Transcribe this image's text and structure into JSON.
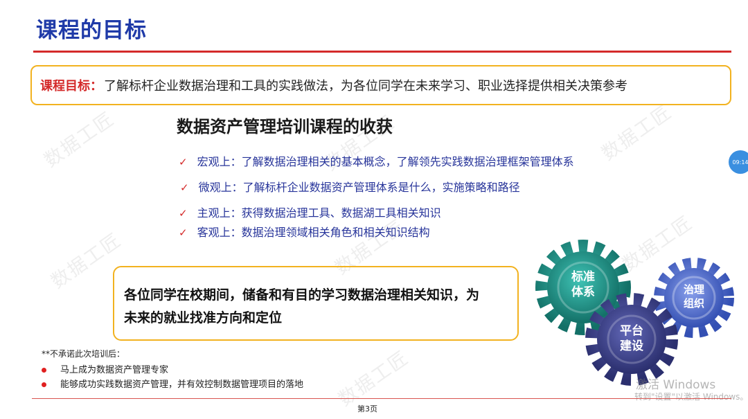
{
  "slide": {
    "title": "课程的目标",
    "goal": {
      "label": "课程目标：",
      "text": "了解标杆企业数据治理和工具的实践做法，为各位同学在未来学习、职业选择提供相关决策参考"
    },
    "gains": {
      "title": "数据资产管理培训课程的收获",
      "check_symbol": "✓",
      "items": [
        {
          "label": "宏观上：",
          "text": "了解数据治理相关的基本概念，了解领先实践数据治理框架管理体系"
        },
        {
          "label": "微观上：",
          "text": "了解标杆企业数据资产管理体系是什么，实施策略和路径"
        },
        {
          "label": "主观上：",
          "text": "获得数据治理工具、数据湖工具相关知识"
        },
        {
          "label": "客观上：",
          "text": "数据治理领域相关角色和相关知识结构"
        }
      ]
    },
    "advice": {
      "line1": "各位同学在校期间，储备和有目的学习数据治理相关知识，为",
      "line2": "未来的就业找准方向和定位"
    },
    "disclaimer": {
      "title": "**不承诺此次培训后：",
      "items": [
        "马上成为数据资产管理专家",
        "能够成功实践数据资产管理，并有效控制数据管理项目的落地"
      ]
    },
    "gears": [
      {
        "line1": "标准",
        "line2": "体系",
        "color": "#1e8f86"
      },
      {
        "line1": "平台",
        "line2": "建设",
        "color": "#3b3f8c"
      },
      {
        "line1": "治理",
        "line2": "组织",
        "color": "#4a63c8"
      }
    ],
    "page_number": "第3页",
    "watermark_text": "数据工匠",
    "time_badge": "09:14"
  },
  "system_overlay": {
    "activate_line1": "激活 Windows",
    "activate_line2": "转到\"设置\"以激活 Windows。"
  },
  "colors": {
    "title_blue": "#1f3aa8",
    "accent_red": "#d42a2a",
    "box_border": "#f2b21f",
    "list_blue": "#27349a"
  }
}
